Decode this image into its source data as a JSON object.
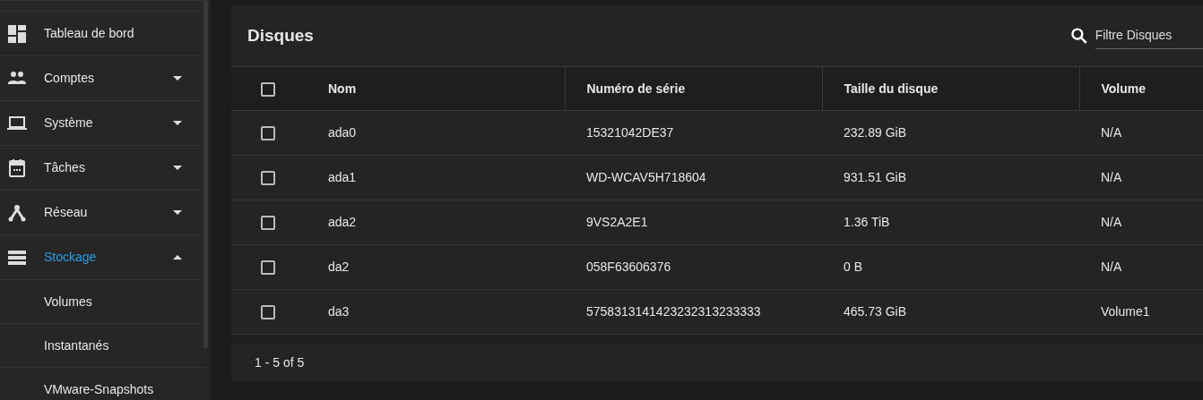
{
  "sidebar": {
    "items": [
      {
        "label": "Tableau de bord",
        "kind": "link",
        "selected": false
      },
      {
        "label": "Comptes",
        "kind": "group",
        "expanded": false,
        "selected": false
      },
      {
        "label": "Système",
        "kind": "group",
        "expanded": false,
        "selected": false
      },
      {
        "label": "Tâches",
        "kind": "group",
        "expanded": false,
        "selected": false
      },
      {
        "label": "Réseau",
        "kind": "group",
        "expanded": false,
        "selected": false
      },
      {
        "label": "Stockage",
        "kind": "group",
        "expanded": true,
        "selected": true,
        "children": [
          {
            "label": "Volumes",
            "selected": false
          },
          {
            "label": "Instantanés",
            "selected": false
          },
          {
            "label": "VMware-Snapshots",
            "selected": false
          }
        ]
      }
    ]
  },
  "card": {
    "title": "Disques",
    "search": {
      "placeholder": "Filtre Disques"
    },
    "table": {
      "select_all": {
        "checked": false
      },
      "columns": [
        "Nom",
        "Numéro de série",
        "Taille du disque",
        "Volume"
      ],
      "rows": [
        {
          "checked": false,
          "cells": [
            "ada0",
            "15321042DE37",
            "232.89 GiB",
            "N/A"
          ]
        },
        {
          "checked": false,
          "cells": [
            "ada1",
            "WD-WCAV5H718604",
            "931.51 GiB",
            "N/A"
          ]
        },
        {
          "checked": false,
          "cells": [
            "ada2",
            "9VS2A2E1",
            "1.36 TiB",
            "N/A"
          ]
        },
        {
          "checked": false,
          "cells": [
            "da2",
            "058F63606376",
            "0 B",
            "N/A"
          ]
        },
        {
          "checked": false,
          "cells": [
            "da3",
            "5758313141423232313233333",
            "465.73 GiB",
            "Volume1"
          ]
        }
      ]
    },
    "paginator": "1 - 5 of 5"
  }
}
